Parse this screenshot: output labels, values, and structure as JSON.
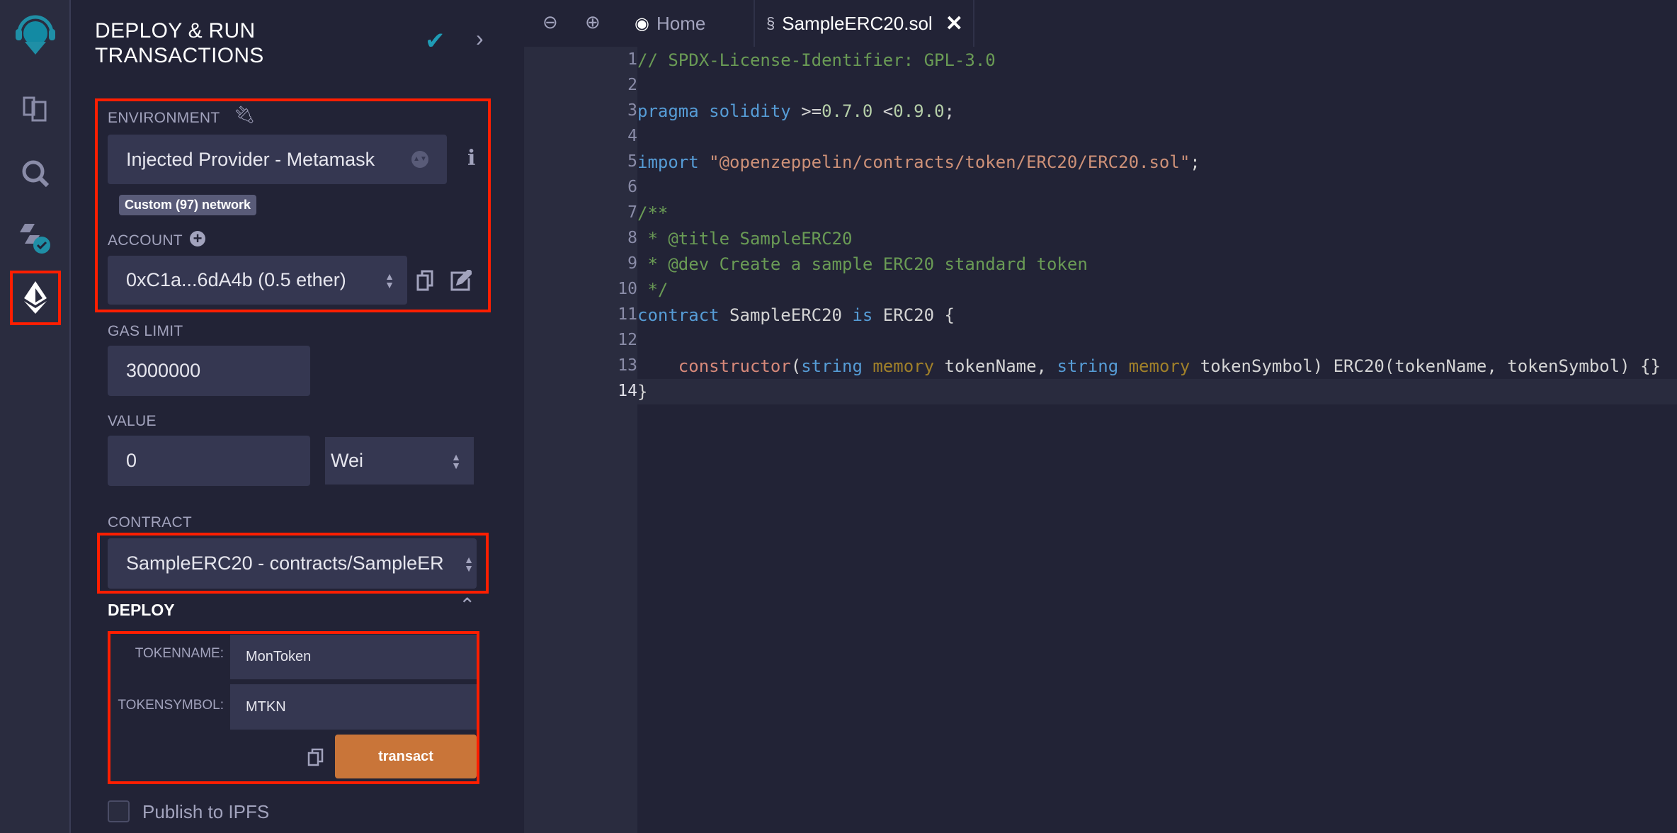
{
  "sidebar": {
    "icons": [
      "remix-logo-icon",
      "file-explorer-icon",
      "search-icon",
      "solidity-compiler-icon",
      "deploy-run-icon"
    ],
    "active": "deploy-run-icon"
  },
  "panel": {
    "title_line1": "DEPLOY & RUN",
    "title_line2": "TRANSACTIONS",
    "environment": {
      "label": "ENVIRONMENT",
      "value": "Injected Provider - Metamask",
      "network_badge": "Custom (97) network"
    },
    "account": {
      "label": "ACCOUNT",
      "value": "0xC1a...6dA4b (0.5 ether)"
    },
    "gas_limit": {
      "label": "GAS LIMIT",
      "value": "3000000"
    },
    "value": {
      "label": "VALUE",
      "amount": "0",
      "unit": "Wei"
    },
    "contract": {
      "label": "CONTRACT",
      "value": "SampleERC20 - contracts/SampleER"
    },
    "deploy": {
      "label": "DEPLOY",
      "params": [
        {
          "label": "TOKENNAME:",
          "value": "MonToken"
        },
        {
          "label": "TOKENSYMBOL:",
          "value": "MTKN"
        }
      ],
      "transact_label": "transact"
    },
    "publish_ipfs": {
      "label": "Publish to IPFS",
      "checked": false
    }
  },
  "editor": {
    "tabs": [
      {
        "label": "Home",
        "active": false
      },
      {
        "label": "SampleERC20.sol",
        "active": true
      }
    ],
    "current_line": 14,
    "lines": [
      [
        [
          "// SPDX-License-Identifier: GPL-3.0",
          "com"
        ]
      ],
      [],
      [
        [
          "pragma solidity",
          "kw"
        ],
        [
          " >=",
          "txt"
        ],
        [
          "0.7.0",
          "num"
        ],
        [
          " <",
          "txt"
        ],
        [
          "0.9.0",
          "num"
        ],
        [
          ";",
          "txt"
        ]
      ],
      [],
      [
        [
          "import",
          "kw"
        ],
        [
          " ",
          "txt"
        ],
        [
          "\"@openzeppelin/contracts/token/ERC20/ERC20.sol\"",
          "str"
        ],
        [
          ";",
          "txt"
        ]
      ],
      [],
      [
        [
          "/**",
          "com"
        ]
      ],
      [
        [
          " * @title SampleERC20",
          "com"
        ]
      ],
      [
        [
          " * @dev Create a sample ERC20 standard token",
          "com"
        ]
      ],
      [
        [
          " */",
          "com"
        ]
      ],
      [
        [
          "contract",
          "kw"
        ],
        [
          " SampleERC20 ",
          "txt"
        ],
        [
          "is",
          "kw"
        ],
        [
          " ERC20 {",
          "txt"
        ]
      ],
      [],
      [
        [
          "    constructor",
          "fn"
        ],
        [
          "(",
          "txt"
        ],
        [
          "string",
          "kw"
        ],
        [
          " ",
          "txt"
        ],
        [
          "memory",
          "mem"
        ],
        [
          " tokenName, ",
          "txt"
        ],
        [
          "string",
          "kw"
        ],
        [
          " ",
          "txt"
        ],
        [
          "memory",
          "mem"
        ],
        [
          " tokenSymbol) ERC20(tokenName, tokenSymbol) {}",
          "txt"
        ]
      ],
      [
        [
          "}",
          "txt"
        ]
      ]
    ]
  },
  "colors": {
    "accent": "#1f9bb5",
    "highlight": "#ff1e00",
    "transact": "#c97539"
  }
}
